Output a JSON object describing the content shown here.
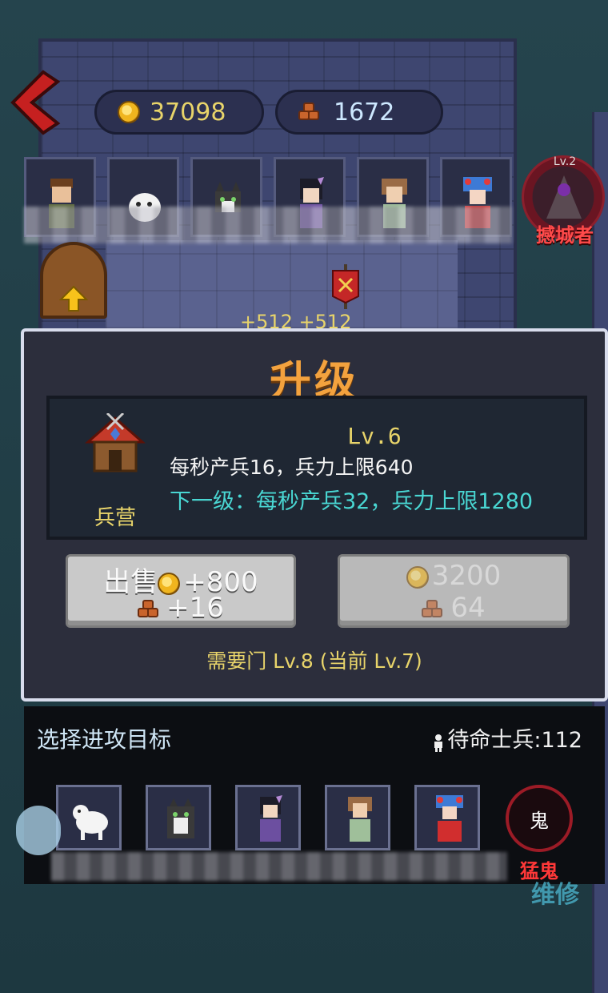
{
  "resources": {
    "gold": "37098",
    "wood": "1672"
  },
  "icons": {
    "back": "back-arrow-icon",
    "gold": "gold-coin-icon",
    "wood": "wood-logs-icon",
    "soldier": "person-icon"
  },
  "boss": {
    "level": "Lv.2",
    "name": "撼城者"
  },
  "floor_reward": "+512 +512",
  "upgrade_panel": {
    "title": "升级",
    "building": {
      "name": "兵营",
      "level": "Lv.6",
      "current_stats": "每秒产兵16，兵力上限640",
      "next_level": "下一级：每秒产兵32，兵力上限1280"
    },
    "sell_button": {
      "label": "出售",
      "gold": "+800",
      "wood": "+16"
    },
    "upgrade_button": {
      "gold": "3200",
      "wood": "64"
    },
    "requirement": "需要门 Lv.8 (当前 Lv.7)"
  },
  "attack_panel": {
    "title": "选择进攻目标",
    "standby_label": "待命士兵:112",
    "ghost_badge": "鬼",
    "ghost_name": "猛鬼"
  },
  "background_label": "维修",
  "colors": {
    "title_orange": "#f3a23e",
    "gold_text": "#e8d46a",
    "next_level_cyan": "#49d6d2",
    "boss_red": "#ff4a4a",
    "panel_bg": "#2c2e3c"
  }
}
